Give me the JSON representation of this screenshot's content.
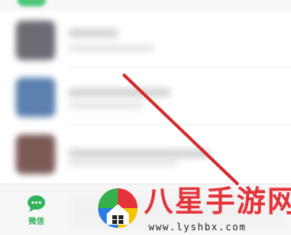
{
  "app": {
    "bottom_nav": {
      "active_tab_label": "微信",
      "active_color": "#2fb35c"
    },
    "chat_list": {
      "items": [
        {
          "avatar_color": "#6c6c75"
        },
        {
          "avatar_color": "#5c80b0"
        },
        {
          "avatar_color": "#7c5b57"
        }
      ]
    },
    "annotation": {
      "arrow_color": "#d42a2a"
    }
  },
  "watermark": {
    "title": "八星手游网",
    "url": "www.lyshbx.com",
    "title_color": "#e5333a"
  }
}
